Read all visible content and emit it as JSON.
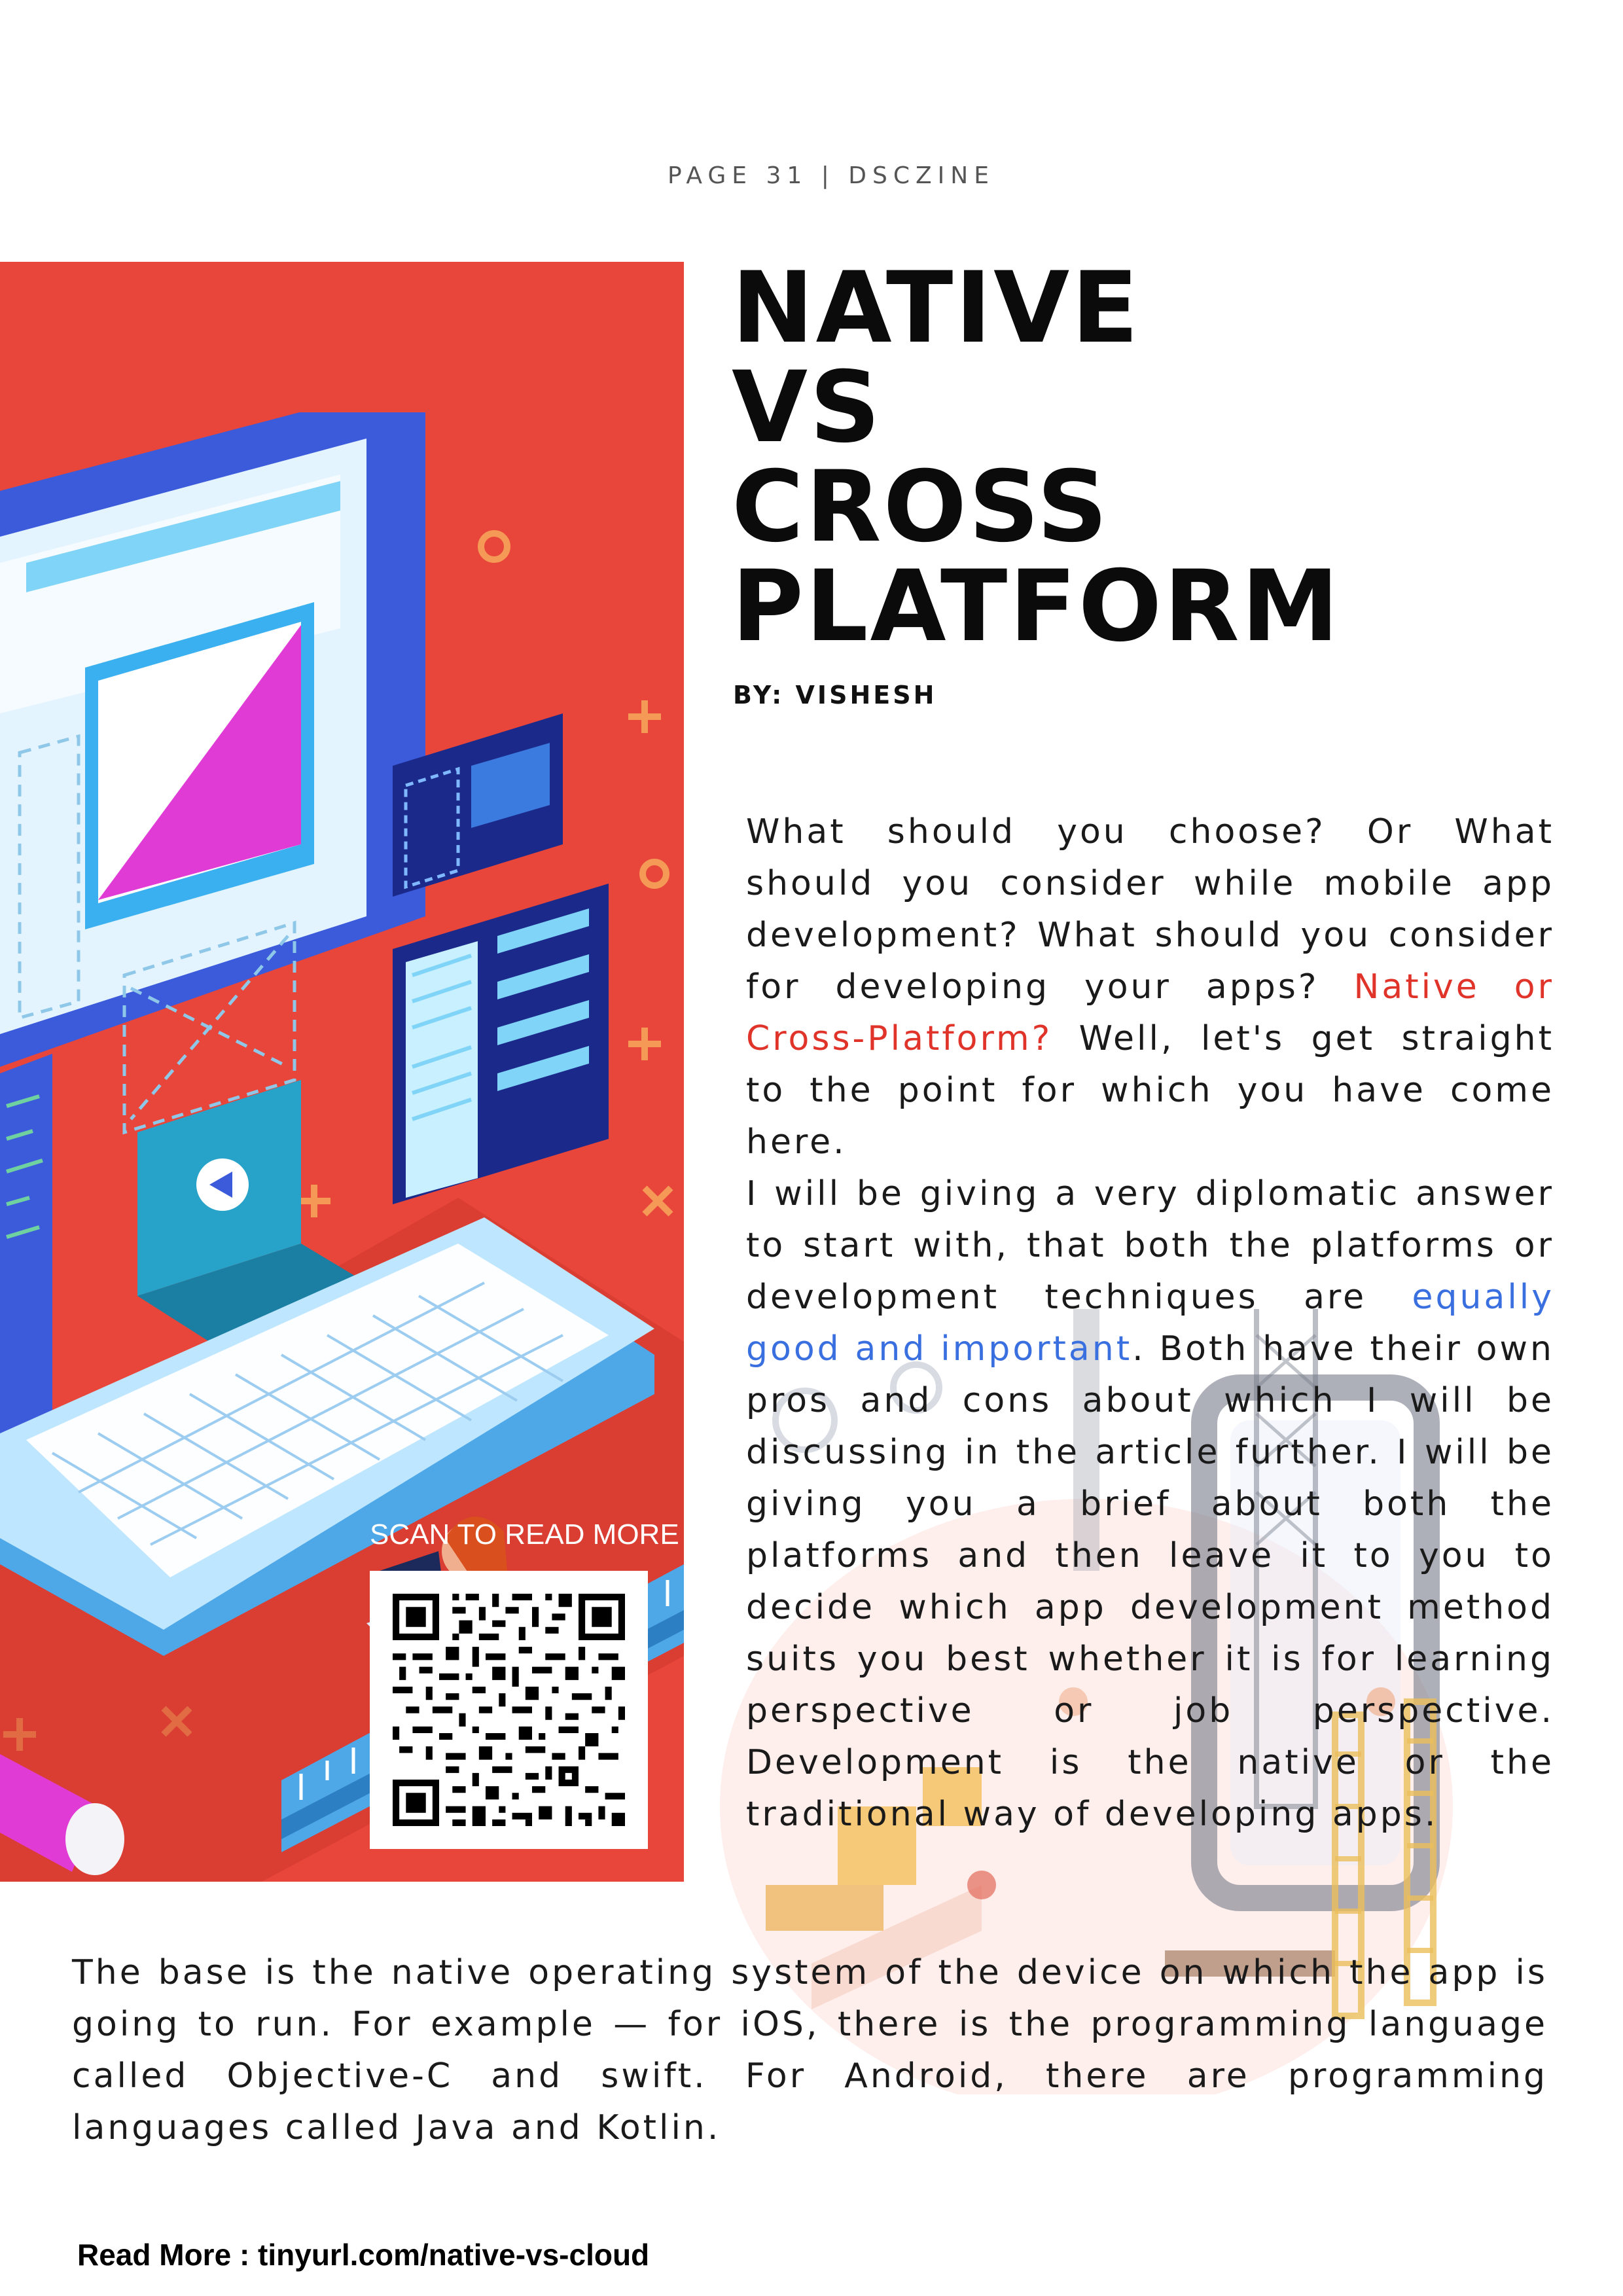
{
  "header": {
    "page_label": "PAGE 31 | DSCZINE"
  },
  "article": {
    "title_lines": [
      "NATIVE",
      "VS",
      "CROSS",
      "PLATFORM"
    ],
    "byline": "BY: VISHESH",
    "intro_part1": "What should you choose? Or What should you consider while mobile app development? What should you consider for developing your apps? ",
    "intro_highlight": "Native or Cross-Platform?",
    "intro_part2": " Well, let's get straight to the point for which you have come here.",
    "para2_part1": "I will be giving a very diplomatic answer to start with, that both the platforms or development techniques are ",
    "para2_highlight": "equally good and important",
    "para2_part2": ". Both have their own pros and cons about which I will be discussing in the article further. I will be giving you a brief about both the platforms and then leave it to you to decide which app development method suits you best whether it is for learning perspective or job perspective. Development is the native or the traditional way of developing apps.",
    "para3": " The base is the native operating system of the device on which the app is going to run. For example — for iOS, there is the programming language called Objective-C and swift. For Android, there are programming languages called Java and Kotlin."
  },
  "qr": {
    "label": "SCAN TO READ MORE"
  },
  "footer": {
    "read_more": "Read More : tinyurl.com/native-vs-cloud"
  },
  "colors": {
    "panel_red": "#e8463a",
    "highlight_red": "#e0342a",
    "highlight_blue": "#3a6fe0",
    "monitor_blue": "#3b5bdb",
    "screen_light": "#e4f4ff"
  },
  "icons": [
    "computer-illustration",
    "qr-code-icon",
    "construction-illustration"
  ]
}
